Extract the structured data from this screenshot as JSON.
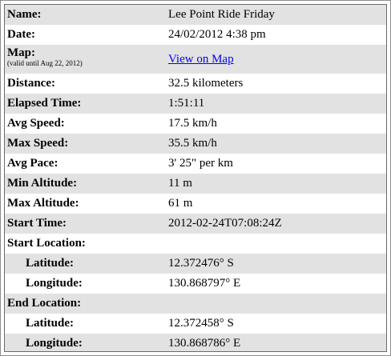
{
  "rows": [
    {
      "label": "Name:",
      "value": "Lee Point Ride Friday"
    },
    {
      "label": "Date:",
      "value": "24/02/2012 4:38 pm"
    },
    {
      "label": "Map:",
      "note": "(valid until Aug 22, 2012)",
      "link": "View on Map"
    },
    {
      "label": "Distance:",
      "value": "32.5 kilometers"
    },
    {
      "label": "Elapsed Time:",
      "value": "1:51:11"
    },
    {
      "label": "Avg Speed:",
      "value": "17.5 km/h"
    },
    {
      "label": "Max Speed:",
      "value": "35.5 km/h"
    },
    {
      "label": "Avg Pace:",
      "value": "3' 25\" per km"
    },
    {
      "label": "Min Altitude:",
      "value": "11 m"
    },
    {
      "label": "Max Altitude:",
      "value": "61 m"
    },
    {
      "label": "Start Time:",
      "value": "2012-02-24T07:08:24Z"
    },
    {
      "label": "Start Location:",
      "value": ""
    },
    {
      "label": "Latitude:",
      "value": "12.372476° S"
    },
    {
      "label": "Longitude:",
      "value": "130.868797° E"
    },
    {
      "label": "End Location:",
      "value": ""
    },
    {
      "label": "Latitude:",
      "value": "12.372458° S"
    },
    {
      "label": "Longitude:",
      "value": "130.868786° E"
    }
  ]
}
